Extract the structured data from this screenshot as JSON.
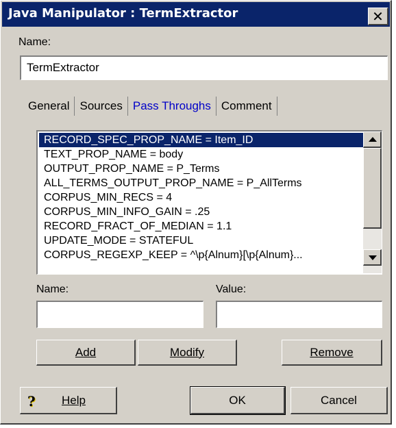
{
  "window": {
    "title": "Java Manipulator : TermExtractor",
    "close_symbol": "✕"
  },
  "name_field": {
    "label": "Name:",
    "value": "TermExtractor"
  },
  "tabs": [
    {
      "label": "General",
      "active": false
    },
    {
      "label": "Sources",
      "active": false
    },
    {
      "label": "Pass Throughs",
      "active": true
    },
    {
      "label": "Comment",
      "active": false
    }
  ],
  "pass_throughs": {
    "items": [
      "RECORD_SPEC_PROP_NAME = Item_ID",
      "TEXT_PROP_NAME = body",
      "OUTPUT_PROP_NAME = P_Terms",
      "ALL_TERMS_OUTPUT_PROP_NAME = P_AllTerms",
      "CORPUS_MIN_RECS = 4",
      "CORPUS_MIN_INFO_GAIN = .25",
      "RECORD_FRACT_OF_MEDIAN = 1.1",
      "UPDATE_MODE = STATEFUL",
      "CORPUS_REGEXP_KEEP = ^\\p{Alnum}[\\p{Alnum}..."
    ],
    "selected_index": 0,
    "name_label": "Name:",
    "name_value": "",
    "value_label": "Value:",
    "value_value": "",
    "add_label": "Add",
    "modify_label": "Modify",
    "remove_label": "Remove"
  },
  "footer": {
    "help_icon": "?",
    "help_label": "Help",
    "ok_label": "OK",
    "cancel_label": "Cancel"
  },
  "colors": {
    "titlebar": "#0a246a",
    "face": "#d4d0c8",
    "selection": "#0a246a",
    "active_tab": "#0000c8"
  }
}
